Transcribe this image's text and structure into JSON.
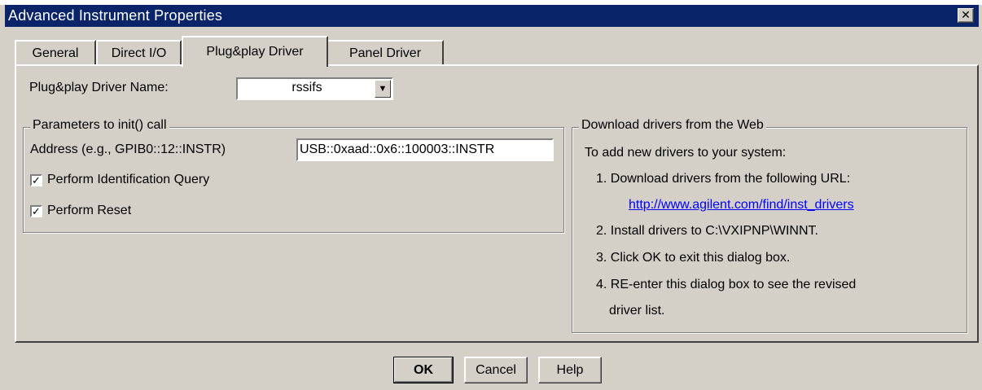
{
  "window": {
    "title": "Advanced Instrument Properties",
    "close_glyph": "✕"
  },
  "tabs": [
    {
      "label": "General",
      "active": false
    },
    {
      "label": "Direct I/O",
      "active": false
    },
    {
      "label": "Plug&play Driver",
      "active": true
    },
    {
      "label": "Panel Driver",
      "active": false
    }
  ],
  "driver": {
    "label": "Plug&play Driver Name:",
    "value": "rssifs",
    "arrow_glyph": "▼"
  },
  "params": {
    "legend": "Parameters to init() call",
    "address_label": "Address (e.g., GPIB0::12::INSTR)",
    "address_value": "USB::0xaad::0x6::100003::INSTR",
    "check_mark": "✓",
    "identification": {
      "label": "Perform Identification Query",
      "checked": true
    },
    "reset": {
      "label": "Perform Reset",
      "checked": true
    }
  },
  "web": {
    "legend": "Download drivers from the Web",
    "intro": "To add new drivers to your system:",
    "step1": "1. Download drivers from the following URL:",
    "link": "http://www.agilent.com/find/inst_drivers",
    "step2": "2. Install drivers to C:\\VXIPNP\\WINNT.",
    "step3": "3. Click OK to exit this dialog box.",
    "step4": "4. RE-enter this dialog box to see the revised",
    "step4b": "driver list."
  },
  "buttons": {
    "ok": "OK",
    "cancel": "Cancel",
    "help": "Help"
  },
  "colors": {
    "titlebar": "#0a246a",
    "face": "#d4d0c8",
    "link": "#0000ff"
  },
  "icons": {
    "close": "close-icon",
    "dropdown": "chevron-down-icon",
    "checkbox": "check-icon"
  }
}
